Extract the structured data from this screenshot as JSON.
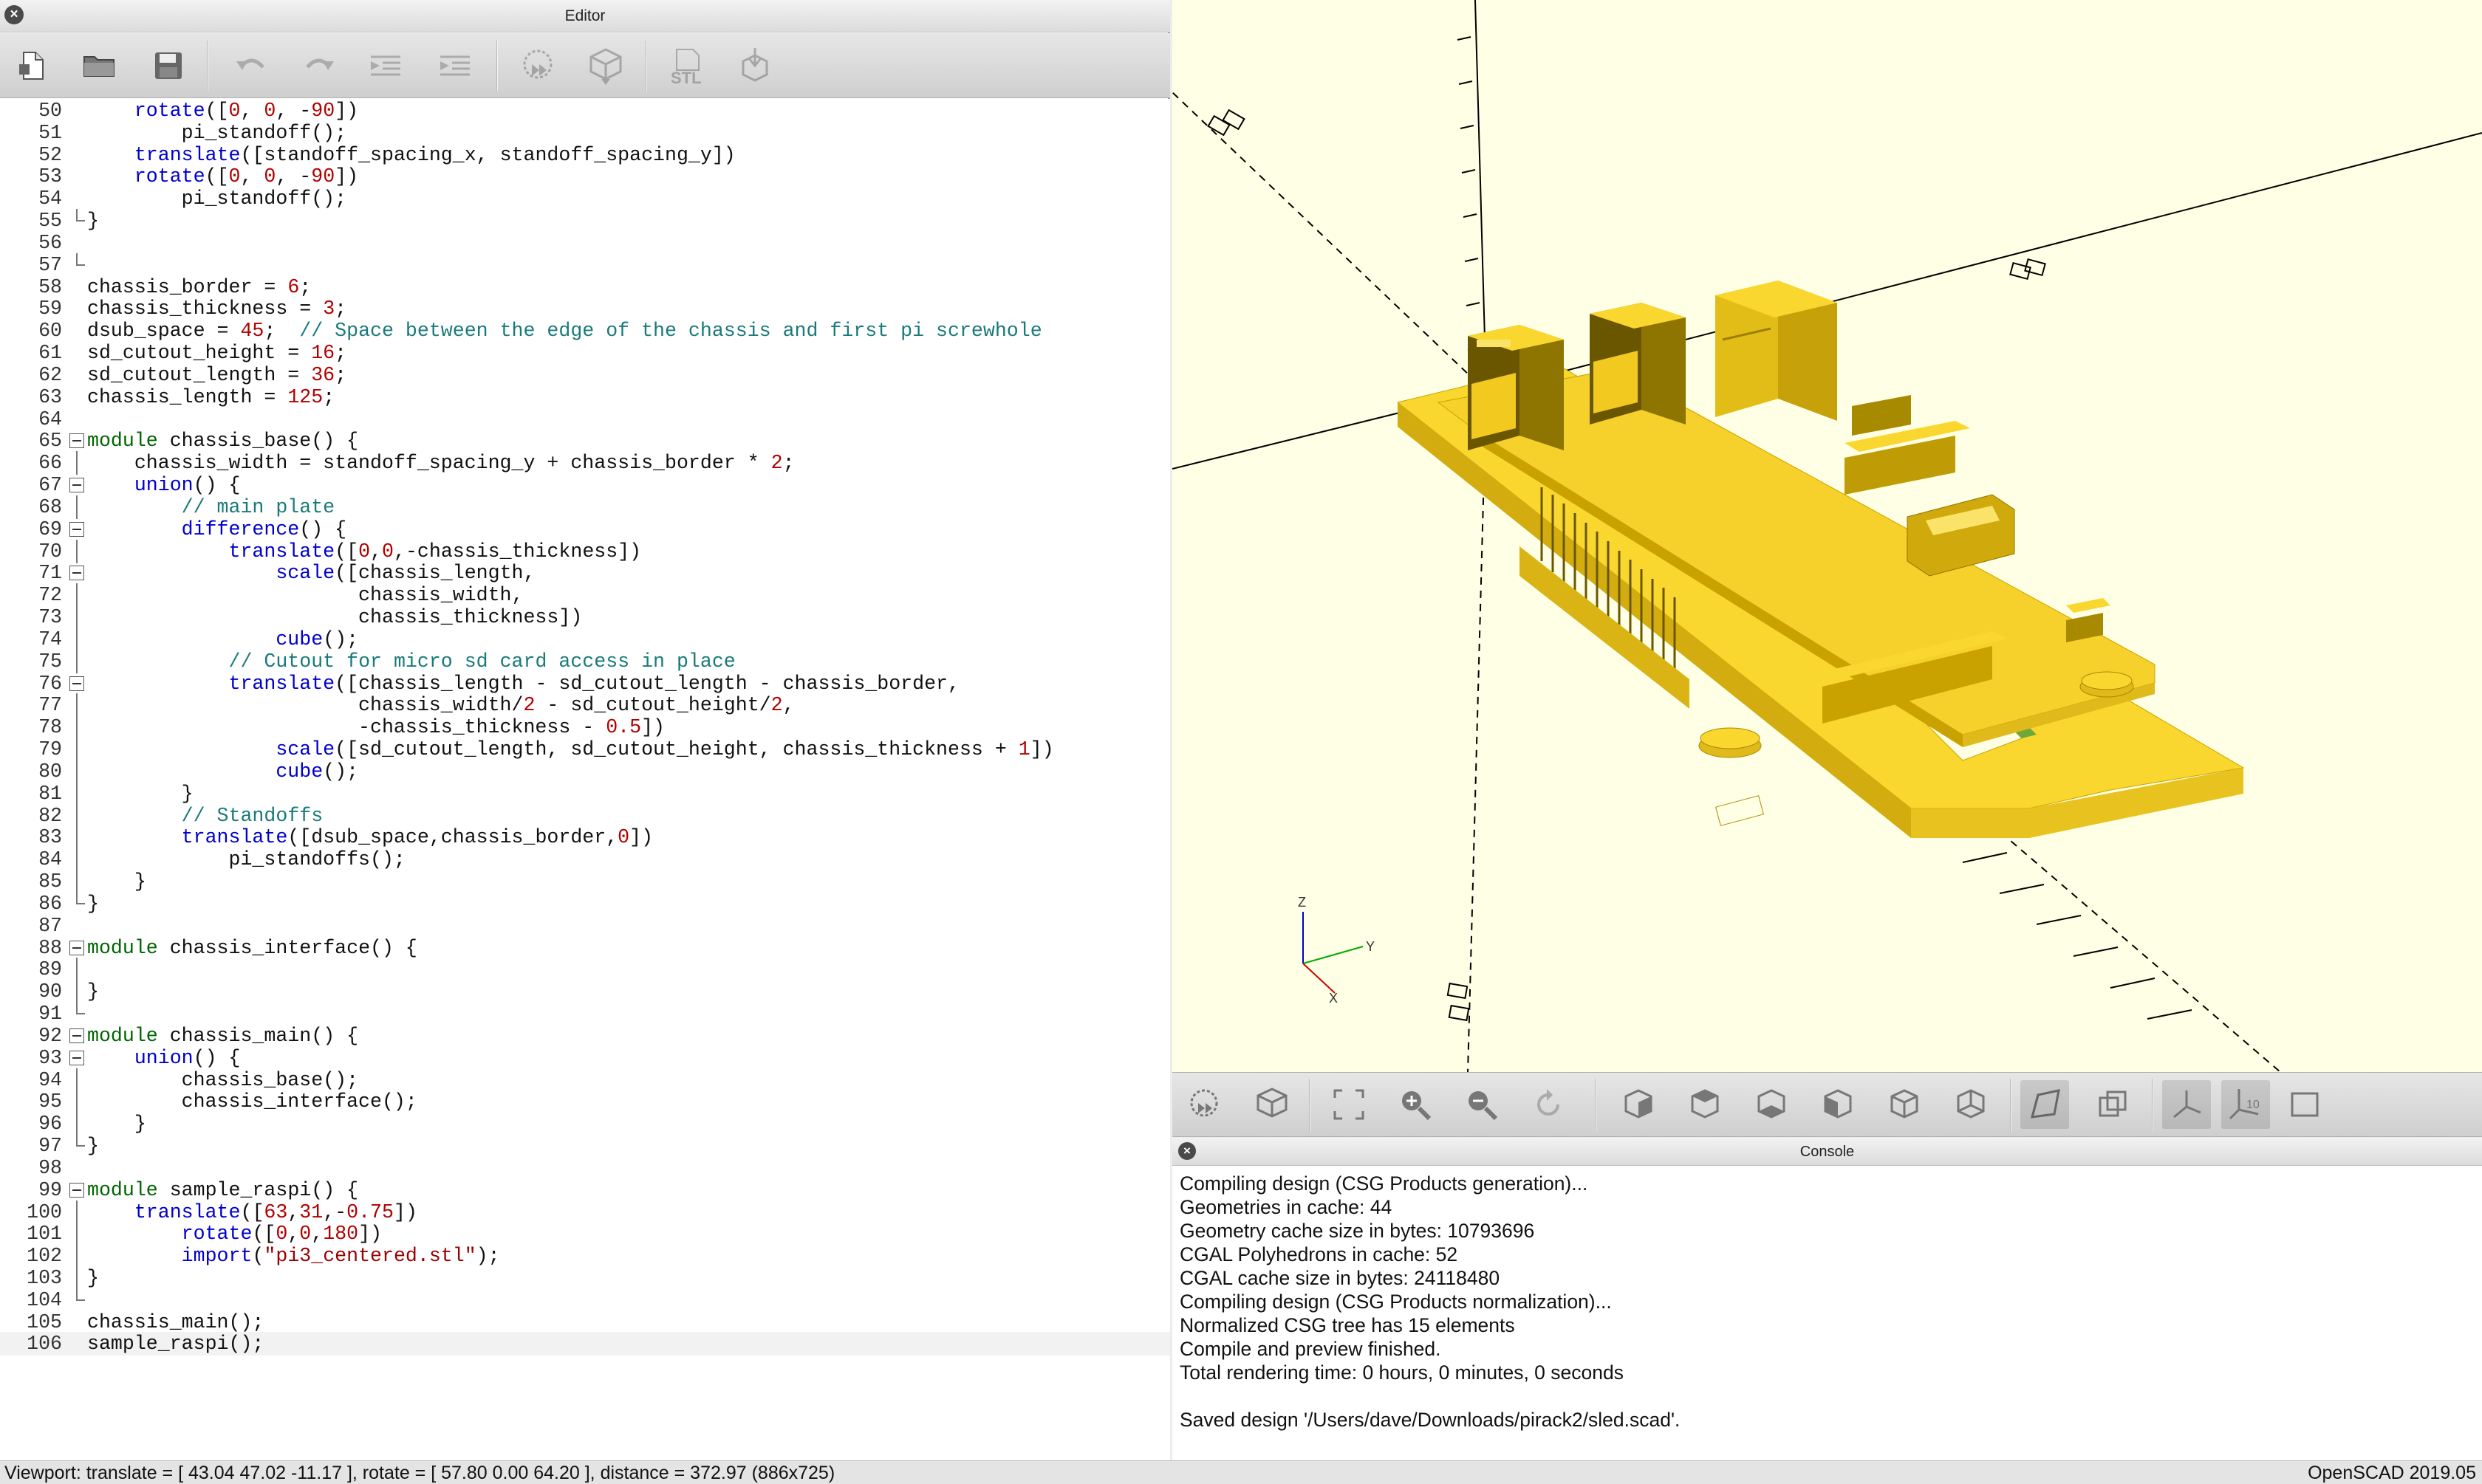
{
  "editor": {
    "title": "Editor",
    "toolbar": [
      "new-file-icon",
      "open-file-icon",
      "save-icon",
      "undo-icon",
      "redo-icon",
      "unindent-icon",
      "indent-icon",
      "preview-icon",
      "render-icon",
      "export-stl-icon",
      "send-to-print-icon"
    ],
    "stl_label": "STL",
    "lines": [
      {
        "n": "50",
        "t": "    rotate([0, 0, -90])"
      },
      {
        "n": "51",
        "t": "        pi_standoff();"
      },
      {
        "n": "52",
        "t": "    translate([standoff_spacing_x, standoff_spacing_y])"
      },
      {
        "n": "53",
        "t": "    rotate([0, 0, -90])"
      },
      {
        "n": "54",
        "t": "        pi_standoff();"
      },
      {
        "n": "55",
        "t": "}"
      },
      {
        "n": "56",
        "t": ""
      },
      {
        "n": "57",
        "t": ""
      },
      {
        "n": "58",
        "t": "chassis_border = 6;"
      },
      {
        "n": "59",
        "t": "chassis_thickness = 3;"
      },
      {
        "n": "60",
        "t": "dsub_space = 45;  // Space between the edge of the chassis and first pi screwhole"
      },
      {
        "n": "61",
        "t": "sd_cutout_height = 16;"
      },
      {
        "n": "62",
        "t": "sd_cutout_length = 36;"
      },
      {
        "n": "63",
        "t": "chassis_length = 125;"
      },
      {
        "n": "64",
        "t": ""
      },
      {
        "n": "65",
        "t": "module chassis_base() {"
      },
      {
        "n": "66",
        "t": "    chassis_width = standoff_spacing_y + chassis_border * 2;"
      },
      {
        "n": "67",
        "t": "    union() {"
      },
      {
        "n": "68",
        "t": "        // main plate"
      },
      {
        "n": "69",
        "t": "        difference() {"
      },
      {
        "n": "70",
        "t": "            translate([0,0,-chassis_thickness])"
      },
      {
        "n": "71",
        "t": "                scale([chassis_length,"
      },
      {
        "n": "72",
        "t": "                       chassis_width,"
      },
      {
        "n": "73",
        "t": "                       chassis_thickness])"
      },
      {
        "n": "74",
        "t": "                cube();"
      },
      {
        "n": "75",
        "t": "            // Cutout for micro sd card access in place"
      },
      {
        "n": "76",
        "t": "            translate([chassis_length - sd_cutout_length - chassis_border,"
      },
      {
        "n": "77",
        "t": "                       chassis_width/2 - sd_cutout_height/2,"
      },
      {
        "n": "78",
        "t": "                       -chassis_thickness - 0.5])"
      },
      {
        "n": "79",
        "t": "                scale([sd_cutout_length, sd_cutout_height, chassis_thickness + 1])"
      },
      {
        "n": "80",
        "t": "                cube();"
      },
      {
        "n": "81",
        "t": "        }"
      },
      {
        "n": "82",
        "t": "        // Standoffs"
      },
      {
        "n": "83",
        "t": "        translate([dsub_space,chassis_border,0])"
      },
      {
        "n": "84",
        "t": "            pi_standoffs();"
      },
      {
        "n": "85",
        "t": "    }"
      },
      {
        "n": "86",
        "t": "}"
      },
      {
        "n": "87",
        "t": ""
      },
      {
        "n": "88",
        "t": "module chassis_interface() {"
      },
      {
        "n": "89",
        "t": ""
      },
      {
        "n": "90",
        "t": "}"
      },
      {
        "n": "91",
        "t": ""
      },
      {
        "n": "92",
        "t": "module chassis_main() {"
      },
      {
        "n": "93",
        "t": "    union() {"
      },
      {
        "n": "94",
        "t": "        chassis_base();"
      },
      {
        "n": "95",
        "t": "        chassis_interface();"
      },
      {
        "n": "96",
        "t": "    }"
      },
      {
        "n": "97",
        "t": "}"
      },
      {
        "n": "98",
        "t": ""
      },
      {
        "n": "99",
        "t": "module sample_raspi() {"
      },
      {
        "n": "100",
        "t": "    translate([63,31,-0.75])"
      },
      {
        "n": "101",
        "t": "        rotate([0,0,180])"
      },
      {
        "n": "102",
        "t": "        import(\"pi3_centered.stl\");"
      },
      {
        "n": "103",
        "t": "}"
      },
      {
        "n": "104",
        "t": ""
      },
      {
        "n": "105",
        "t": "chassis_main();"
      },
      {
        "n": "106",
        "t": "sample_raspi();"
      }
    ]
  },
  "viewport": {
    "background": "#ffffe5",
    "model_color": "#f9d72f",
    "axis_labels": {
      "z": "Z",
      "y": "Y",
      "x": "X"
    }
  },
  "view_toolbar": [
    "preview-icon",
    "render-icon",
    "view-all-icon",
    "zoom-in-icon",
    "zoom-out-icon",
    "reset-view-icon",
    "view-right-icon",
    "view-top-icon",
    "view-bottom-icon",
    "view-left-icon",
    "view-front-icon",
    "view-back-icon",
    "perspective-icon",
    "orthogonal-icon",
    "show-axes-icon",
    "show-scale-icon",
    "show-edges-icon"
  ],
  "console": {
    "title": "Console",
    "lines": [
      "Compiling design (CSG Products generation)...",
      "Geometries in cache: 44",
      "Geometry cache size in bytes: 10793696",
      "CGAL Polyhedrons in cache: 52",
      "CGAL cache size in bytes: 24118480",
      "Compiling design (CSG Products normalization)...",
      "Normalized CSG tree has 15 elements",
      "Compile and preview finished.",
      "Total rendering time: 0 hours, 0 minutes, 0 seconds",
      "",
      "Saved design '/Users/dave/Downloads/pirack2/sled.scad'."
    ]
  },
  "statusbar": {
    "viewport_info": "Viewport: translate = [ 43.04 47.02 -11.17 ], rotate = [ 57.80 0.00 64.20 ], distance = 372.97 (886x725)",
    "version": "OpenSCAD 2019.05"
  }
}
